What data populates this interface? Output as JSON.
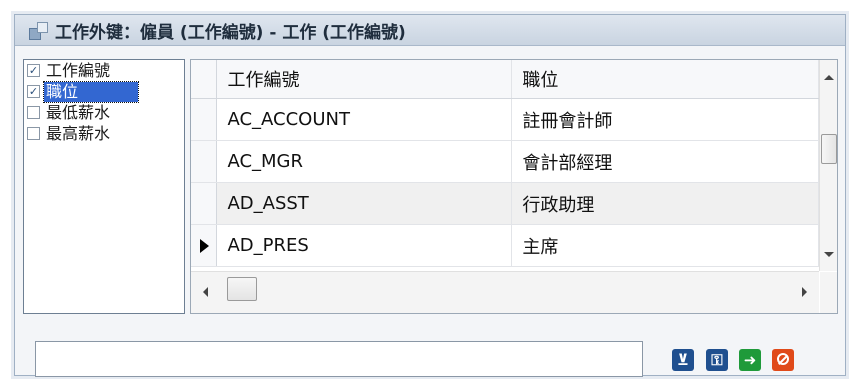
{
  "window": {
    "title": "工作外键：僱員 (工作編號) - 工作 (工作編號)"
  },
  "field_list": [
    {
      "label": "工作編號",
      "checked": true,
      "selected": false
    },
    {
      "label": "職位",
      "checked": true,
      "selected": true
    },
    {
      "label": "最低薪水",
      "checked": false,
      "selected": false
    },
    {
      "label": "最高薪水",
      "checked": false,
      "selected": false
    }
  ],
  "grid": {
    "columns": [
      "工作編號",
      "職位"
    ],
    "rows": [
      {
        "job_id": "AC_ACCOUNT",
        "title": "註冊會計師",
        "current": false
      },
      {
        "job_id": "AC_MGR",
        "title": "會計部經理",
        "current": false
      },
      {
        "job_id": "AD_ASST",
        "title": "行政助理",
        "current": false
      },
      {
        "job_id": "AD_PRES",
        "title": "主席",
        "current": true
      }
    ]
  },
  "filter": {
    "value": ""
  },
  "toolbar": {
    "filter_icon": "filter-icon",
    "key_icon": "key-icon",
    "go_icon": "arrow-right-icon",
    "cancel_icon": "cancel-icon"
  },
  "colors": {
    "selection": "#3367d1",
    "filter_btn": "#1f4f8f",
    "go_btn": "#1f9a3a",
    "cancel_btn": "#e04a1a"
  }
}
